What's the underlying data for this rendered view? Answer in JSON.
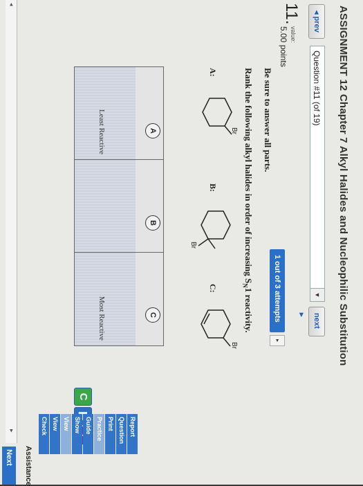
{
  "header": {
    "assignment_title": "ASSIGNMENT 12 Chapter 7 Alkyl Halides and Nucleophilic Substitution",
    "prev_label": "◂ prev",
    "question_selector": "Question #11 (of 19)",
    "next_label": "next ▸"
  },
  "question": {
    "number": "11.",
    "value_label": "value:",
    "points": "5.00 points",
    "attempts": "1 out of 3 attempts",
    "instruction": "Be sure to answer all parts.",
    "prompt": "Rank the following alkyl halides in order of increasing SN1 reactivity.",
    "prompt_pre": "Rank the following alkyl halides in order of increasing S",
    "prompt_sub": "N",
    "prompt_post": "1 reactivity."
  },
  "molecules": [
    {
      "label": "A:",
      "substituent": "Br"
    },
    {
      "label": "B:",
      "substituent": "Br"
    },
    {
      "label": "C:",
      "substituent": "Br"
    }
  ],
  "ranking": {
    "choices": [
      "A",
      "B",
      "C"
    ],
    "least_label": "Least Reactive",
    "most_label": "Most Reactive"
  },
  "tools": [
    "C",
    "calculator",
    "?"
  ],
  "sidebar": {
    "next_label": "Next",
    "assist_title": "Assistance",
    "items": [
      {
        "label": "Check",
        "dim": false
      },
      {
        "label": "View",
        "dim": false
      },
      {
        "label": "View",
        "dim": true
      },
      {
        "label": "Show",
        "dim": false
      },
      {
        "label": "Guide",
        "dim": false
      },
      {
        "label": "Practice",
        "dim": true
      },
      {
        "label": "Print",
        "dim": false
      },
      {
        "label": "Question",
        "dim": false
      },
      {
        "label": "Report",
        "dim": false
      }
    ]
  },
  "colors": {
    "accent": "#2a70c8",
    "tool_green": "#3aa84a",
    "tool_blue": "#2f6fc2",
    "tool_purple": "#6a3fb0"
  }
}
